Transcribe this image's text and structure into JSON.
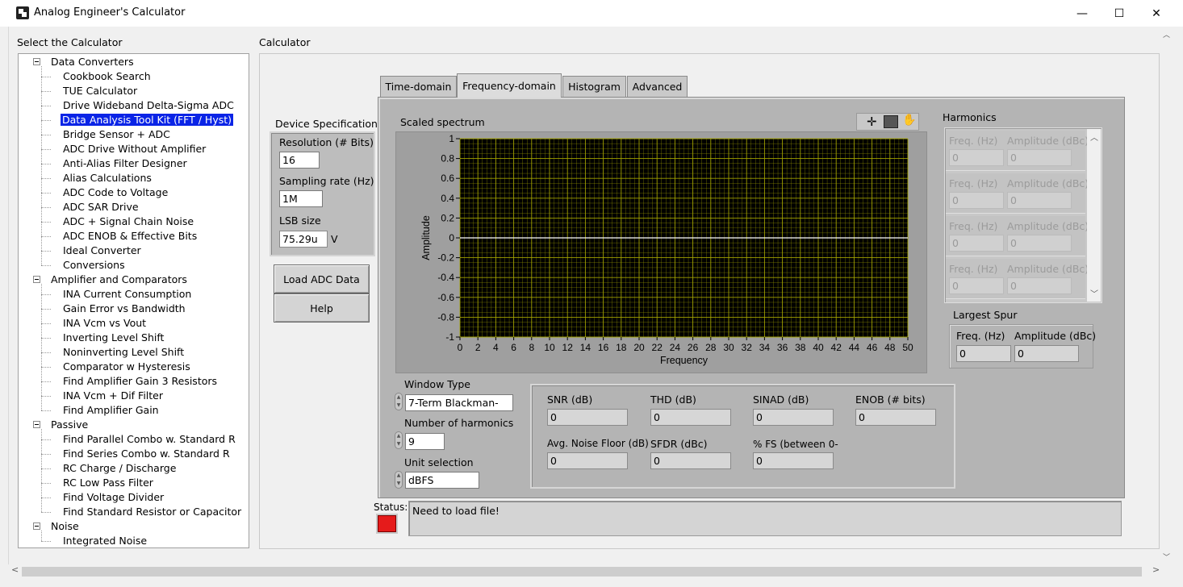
{
  "window": {
    "title": "Analog Engineer's Calculator",
    "minimize": "—",
    "maximize": "☐",
    "close": "✕"
  },
  "left_panel": {
    "label": "Select the Calculator",
    "groups": [
      {
        "name": "Data Converters",
        "items": [
          "Cookbook Search",
          "TUE Calculator",
          "Drive Wideband Delta-Sigma ADC",
          "Data Analysis Tool Kit (FFT / Hyst)",
          "Bridge Sensor + ADC",
          "ADC Drive Without Amplifier",
          "Anti-Alias Filter Designer",
          "Alias Calculations",
          "ADC Code to Voltage",
          "ADC SAR Drive",
          "ADC + Signal Chain Noise",
          "ADC ENOB & Effective Bits",
          "Ideal Converter",
          "Conversions"
        ]
      },
      {
        "name": "Amplifier and Comparators",
        "items": [
          "INA Current Consumption",
          "Gain Error vs Bandwidth",
          "INA Vcm vs Vout",
          "Inverting Level Shift",
          "Noninverting Level Shift",
          "Comparator w Hysteresis",
          "Find Amplifier Gain 3 Resistors",
          "INA Vcm + Dif Filter",
          "Find Amplifier Gain"
        ]
      },
      {
        "name": "Passive",
        "items": [
          "Find Parallel Combo w. Standard R",
          "Find Series Combo w. Standard R",
          "RC Charge / Discharge",
          "RC Low Pass Filter",
          "Find Voltage Divider",
          "Find Standard Resistor or Capacitor"
        ]
      },
      {
        "name": "Noise",
        "items": [
          "Integrated Noise"
        ]
      }
    ],
    "selected": "Data Analysis Tool Kit (FFT / Hyst)"
  },
  "calculator": {
    "label": "Calculator",
    "device_specs": {
      "label": "Device Specifications:",
      "resolution_label": "Resolution (# Bits)",
      "resolution": "16",
      "sampling_label": "Sampling rate (Hz)",
      "sampling": "1M",
      "lsb_label": "LSB size",
      "lsb": "75.29u",
      "lsb_unit": "V"
    },
    "buttons": {
      "load": "Load ADC Data",
      "help": "Help"
    },
    "tabs": [
      "Time-domain",
      "Frequency-domain",
      "Histogram",
      "Advanced"
    ],
    "active_tab": "Frequency-domain",
    "graph": {
      "title": "Scaled spectrum"
    },
    "harmonics": {
      "label": "Harmonics",
      "freq_label": "Freq. (Hz)",
      "amp_label": "Amplitude (dBc)",
      "rows": [
        {
          "freq": "0",
          "amp": "0"
        },
        {
          "freq": "0",
          "amp": "0"
        },
        {
          "freq": "0",
          "amp": "0"
        },
        {
          "freq": "0",
          "amp": "0"
        }
      ]
    },
    "largest_spur": {
      "label": "Largest Spur",
      "freq_label": "Freq. (Hz)",
      "amp_label": "Amplitude (dBc)",
      "freq": "0",
      "amp": "0"
    },
    "window_type": {
      "label": "Window Type",
      "value": "7-Term Blackman-"
    },
    "num_harmonics": {
      "label": "Number of harmonics",
      "value": "9"
    },
    "unit_selection": {
      "label": "Unit selection",
      "value": "dBFS"
    },
    "metrics": {
      "snr_label": "SNR (dB)",
      "snr": "0",
      "thd_label": "THD (dB)",
      "thd": "0",
      "sinad_label": "SINAD (dB)",
      "sinad": "0",
      "enob_label": "ENOB (# bits)",
      "enob": "0",
      "noise_label": "Avg. Noise Floor (dB)",
      "noise": "0",
      "sfdr_label": "SFDR (dBc)",
      "sfdr": "0",
      "fs_label": "% FS (between 0-",
      "fs": "0"
    },
    "status": {
      "label": "Status:",
      "text": "Need to load file!",
      "led_color": "#e51b1b"
    }
  },
  "chart_data": {
    "type": "line",
    "title": "Scaled spectrum",
    "xlabel": "Frequency",
    "ylabel": "Amplitude",
    "xlim": [
      0,
      50
    ],
    "ylim": [
      -1,
      1
    ],
    "x_ticks": [
      0,
      2,
      4,
      6,
      8,
      10,
      12,
      14,
      16,
      18,
      20,
      22,
      24,
      26,
      28,
      30,
      32,
      34,
      36,
      38,
      40,
      42,
      44,
      46,
      48,
      50
    ],
    "y_ticks": [
      1,
      0.8,
      0.6,
      0.4,
      0.2,
      0,
      -0.2,
      -0.4,
      -0.6,
      -0.8,
      -1
    ],
    "y_tick_labels": [
      "1",
      "0.8",
      "0.6",
      "0.4",
      "0.2",
      "0",
      "-0.2",
      "-0.4",
      "-0.6",
      "-0.8",
      "-1"
    ],
    "series": [
      {
        "name": "",
        "x": [
          0,
          50
        ],
        "y": [
          0,
          0
        ]
      }
    ],
    "grid": true,
    "background": "#000000",
    "grid_color": "#a8a800",
    "series_color": "#ffffff"
  }
}
